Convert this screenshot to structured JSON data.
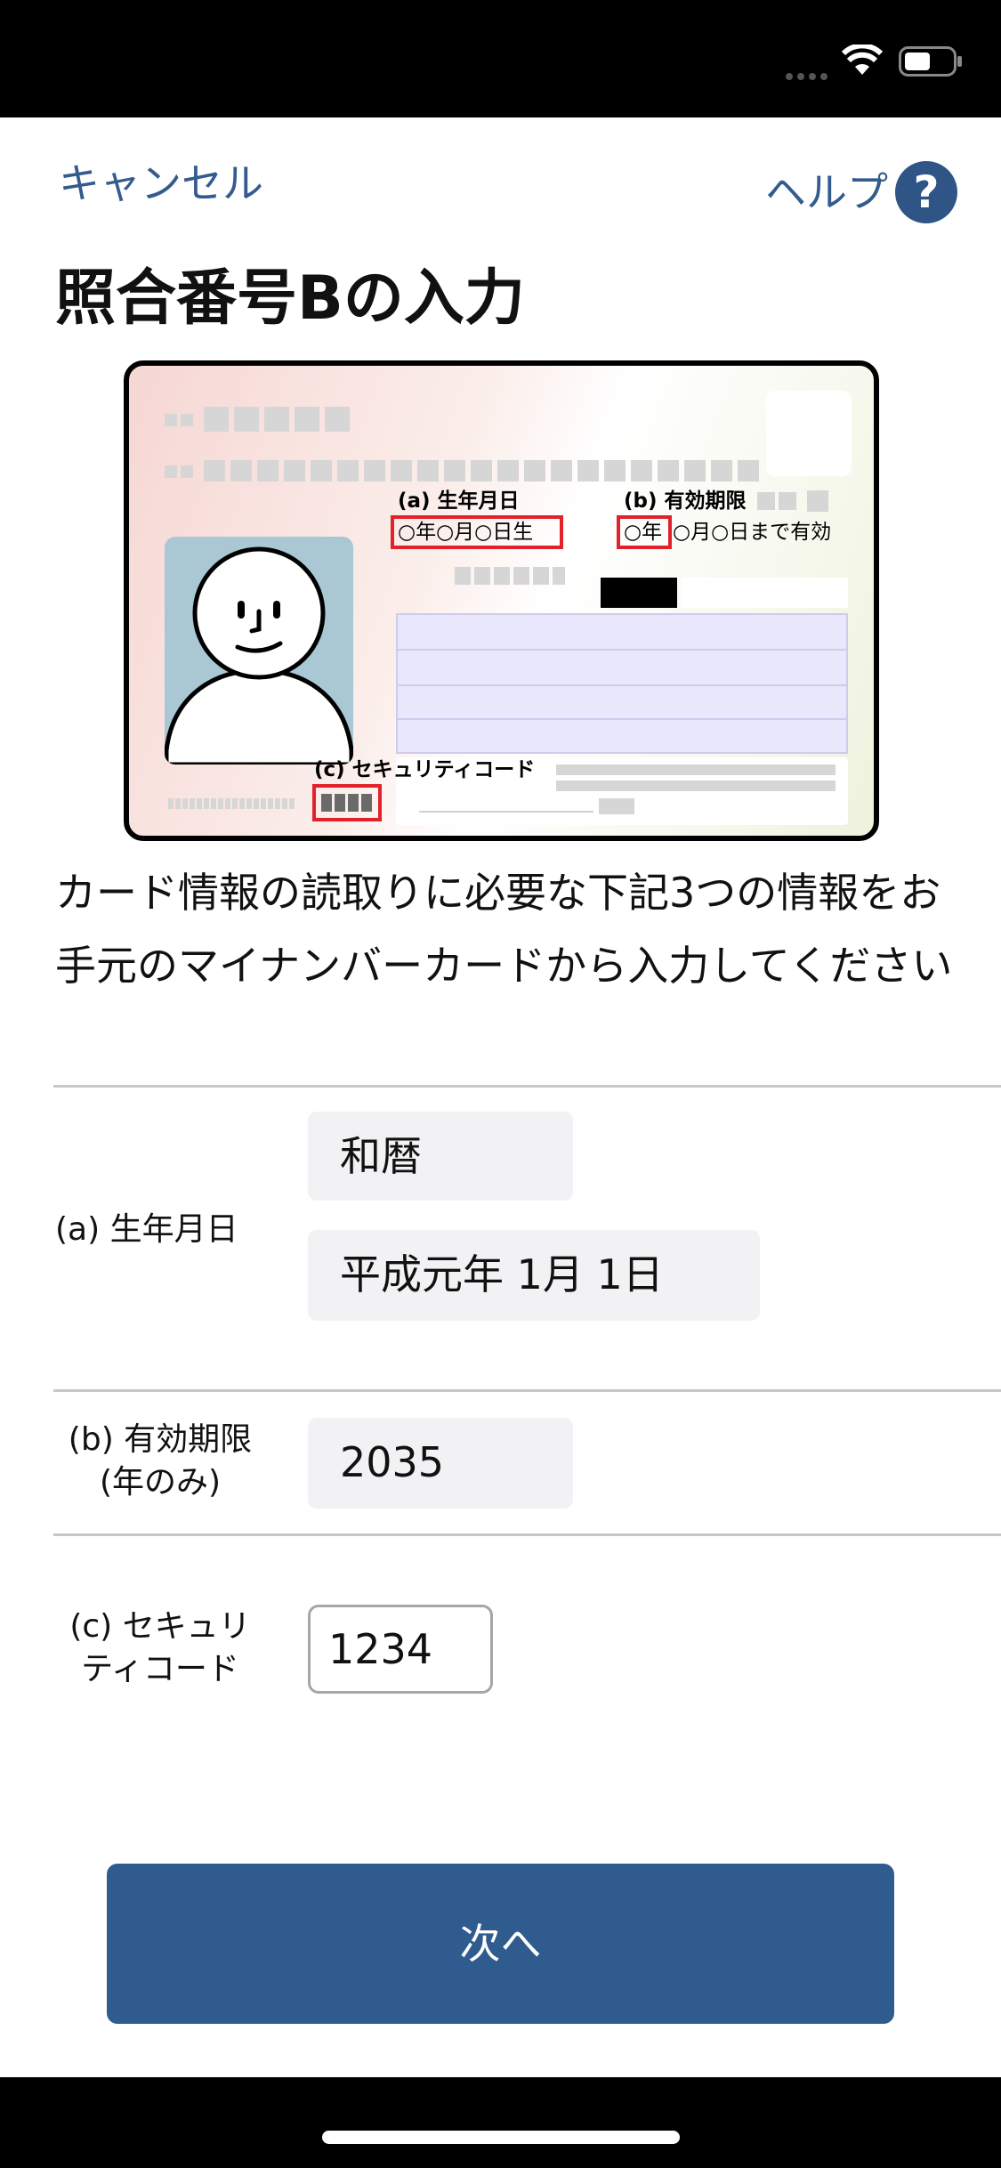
{
  "nav": {
    "cancel_label": "キャンセル",
    "help_label": "ヘルプ",
    "help_icon_glyph": "?"
  },
  "title": "照合番号Bの入力",
  "card_illustration": {
    "label_a": "(a) 生年月日",
    "value_a": "○年○月○日生",
    "label_b": "(b) 有効期限",
    "value_b_year": "○年",
    "value_b_rest": "○月○日まで有効",
    "label_c": "(c) セキュリティコード"
  },
  "intro_text": "カード情報の読取りに必要な下記3つの情報をお手元のマイナンバーカードから入力してください",
  "form": {
    "birthdate": {
      "label": "(a) 生年月日",
      "era": "和暦",
      "date": "平成元年 1月 1日"
    },
    "expiry": {
      "label_line1": "(b) 有効期限",
      "label_line2": "(年のみ)",
      "value": "2035"
    },
    "security": {
      "label_line1": "(c) セキュリ",
      "label_line2": "ティコード",
      "value": "1234"
    }
  },
  "next_label": "次へ",
  "colors": {
    "accent": "#2f5b8f",
    "link": "#335b8e",
    "highlight_red": "#e2222a"
  }
}
